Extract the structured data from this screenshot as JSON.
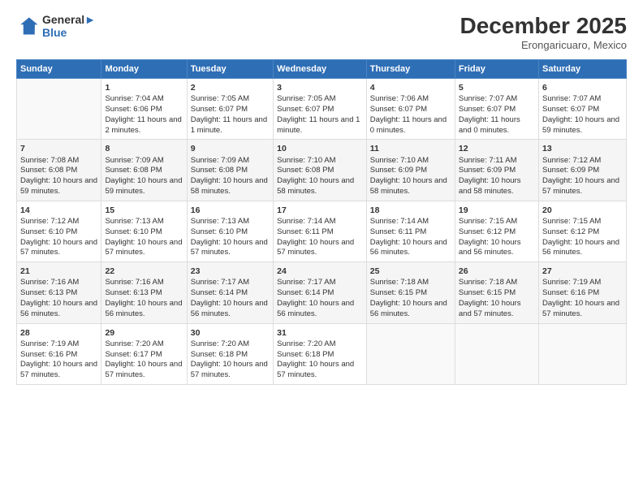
{
  "logo": {
    "line1": "General",
    "line2": "Blue"
  },
  "title": "December 2025",
  "location": "Erongaricuaro, Mexico",
  "days": [
    "Sunday",
    "Monday",
    "Tuesday",
    "Wednesday",
    "Thursday",
    "Friday",
    "Saturday"
  ],
  "weeks": [
    [
      {
        "date": "",
        "sunrise": "",
        "sunset": "",
        "daylight": ""
      },
      {
        "date": "1",
        "sunrise": "Sunrise: 7:04 AM",
        "sunset": "Sunset: 6:06 PM",
        "daylight": "Daylight: 11 hours and 2 minutes."
      },
      {
        "date": "2",
        "sunrise": "Sunrise: 7:05 AM",
        "sunset": "Sunset: 6:07 PM",
        "daylight": "Daylight: 11 hours and 1 minute."
      },
      {
        "date": "3",
        "sunrise": "Sunrise: 7:05 AM",
        "sunset": "Sunset: 6:07 PM",
        "daylight": "Daylight: 11 hours and 1 minute."
      },
      {
        "date": "4",
        "sunrise": "Sunrise: 7:06 AM",
        "sunset": "Sunset: 6:07 PM",
        "daylight": "Daylight: 11 hours and 0 minutes."
      },
      {
        "date": "5",
        "sunrise": "Sunrise: 7:07 AM",
        "sunset": "Sunset: 6:07 PM",
        "daylight": "Daylight: 11 hours and 0 minutes."
      },
      {
        "date": "6",
        "sunrise": "Sunrise: 7:07 AM",
        "sunset": "Sunset: 6:07 PM",
        "daylight": "Daylight: 10 hours and 59 minutes."
      }
    ],
    [
      {
        "date": "7",
        "sunrise": "Sunrise: 7:08 AM",
        "sunset": "Sunset: 6:08 PM",
        "daylight": "Daylight: 10 hours and 59 minutes."
      },
      {
        "date": "8",
        "sunrise": "Sunrise: 7:09 AM",
        "sunset": "Sunset: 6:08 PM",
        "daylight": "Daylight: 10 hours and 59 minutes."
      },
      {
        "date": "9",
        "sunrise": "Sunrise: 7:09 AM",
        "sunset": "Sunset: 6:08 PM",
        "daylight": "Daylight: 10 hours and 58 minutes."
      },
      {
        "date": "10",
        "sunrise": "Sunrise: 7:10 AM",
        "sunset": "Sunset: 6:08 PM",
        "daylight": "Daylight: 10 hours and 58 minutes."
      },
      {
        "date": "11",
        "sunrise": "Sunrise: 7:10 AM",
        "sunset": "Sunset: 6:09 PM",
        "daylight": "Daylight: 10 hours and 58 minutes."
      },
      {
        "date": "12",
        "sunrise": "Sunrise: 7:11 AM",
        "sunset": "Sunset: 6:09 PM",
        "daylight": "Daylight: 10 hours and 58 minutes."
      },
      {
        "date": "13",
        "sunrise": "Sunrise: 7:12 AM",
        "sunset": "Sunset: 6:09 PM",
        "daylight": "Daylight: 10 hours and 57 minutes."
      }
    ],
    [
      {
        "date": "14",
        "sunrise": "Sunrise: 7:12 AM",
        "sunset": "Sunset: 6:10 PM",
        "daylight": "Daylight: 10 hours and 57 minutes."
      },
      {
        "date": "15",
        "sunrise": "Sunrise: 7:13 AM",
        "sunset": "Sunset: 6:10 PM",
        "daylight": "Daylight: 10 hours and 57 minutes."
      },
      {
        "date": "16",
        "sunrise": "Sunrise: 7:13 AM",
        "sunset": "Sunset: 6:10 PM",
        "daylight": "Daylight: 10 hours and 57 minutes."
      },
      {
        "date": "17",
        "sunrise": "Sunrise: 7:14 AM",
        "sunset": "Sunset: 6:11 PM",
        "daylight": "Daylight: 10 hours and 57 minutes."
      },
      {
        "date": "18",
        "sunrise": "Sunrise: 7:14 AM",
        "sunset": "Sunset: 6:11 PM",
        "daylight": "Daylight: 10 hours and 56 minutes."
      },
      {
        "date": "19",
        "sunrise": "Sunrise: 7:15 AM",
        "sunset": "Sunset: 6:12 PM",
        "daylight": "Daylight: 10 hours and 56 minutes."
      },
      {
        "date": "20",
        "sunrise": "Sunrise: 7:15 AM",
        "sunset": "Sunset: 6:12 PM",
        "daylight": "Daylight: 10 hours and 56 minutes."
      }
    ],
    [
      {
        "date": "21",
        "sunrise": "Sunrise: 7:16 AM",
        "sunset": "Sunset: 6:13 PM",
        "daylight": "Daylight: 10 hours and 56 minutes."
      },
      {
        "date": "22",
        "sunrise": "Sunrise: 7:16 AM",
        "sunset": "Sunset: 6:13 PM",
        "daylight": "Daylight: 10 hours and 56 minutes."
      },
      {
        "date": "23",
        "sunrise": "Sunrise: 7:17 AM",
        "sunset": "Sunset: 6:14 PM",
        "daylight": "Daylight: 10 hours and 56 minutes."
      },
      {
        "date": "24",
        "sunrise": "Sunrise: 7:17 AM",
        "sunset": "Sunset: 6:14 PM",
        "daylight": "Daylight: 10 hours and 56 minutes."
      },
      {
        "date": "25",
        "sunrise": "Sunrise: 7:18 AM",
        "sunset": "Sunset: 6:15 PM",
        "daylight": "Daylight: 10 hours and 56 minutes."
      },
      {
        "date": "26",
        "sunrise": "Sunrise: 7:18 AM",
        "sunset": "Sunset: 6:15 PM",
        "daylight": "Daylight: 10 hours and 57 minutes."
      },
      {
        "date": "27",
        "sunrise": "Sunrise: 7:19 AM",
        "sunset": "Sunset: 6:16 PM",
        "daylight": "Daylight: 10 hours and 57 minutes."
      }
    ],
    [
      {
        "date": "28",
        "sunrise": "Sunrise: 7:19 AM",
        "sunset": "Sunset: 6:16 PM",
        "daylight": "Daylight: 10 hours and 57 minutes."
      },
      {
        "date": "29",
        "sunrise": "Sunrise: 7:20 AM",
        "sunset": "Sunset: 6:17 PM",
        "daylight": "Daylight: 10 hours and 57 minutes."
      },
      {
        "date": "30",
        "sunrise": "Sunrise: 7:20 AM",
        "sunset": "Sunset: 6:18 PM",
        "daylight": "Daylight: 10 hours and 57 minutes."
      },
      {
        "date": "31",
        "sunrise": "Sunrise: 7:20 AM",
        "sunset": "Sunset: 6:18 PM",
        "daylight": "Daylight: 10 hours and 57 minutes."
      },
      {
        "date": "",
        "sunrise": "",
        "sunset": "",
        "daylight": ""
      },
      {
        "date": "",
        "sunrise": "",
        "sunset": "",
        "daylight": ""
      },
      {
        "date": "",
        "sunrise": "",
        "sunset": "",
        "daylight": ""
      }
    ]
  ]
}
